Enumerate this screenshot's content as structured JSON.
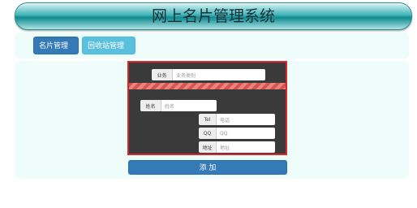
{
  "header": {
    "title": "网上名片管理系统"
  },
  "nav": {
    "cards_menu": "名片管理",
    "recycle_menu": "回收站管理"
  },
  "form": {
    "business": {
      "label": "业务",
      "placeholder": "业务类别"
    },
    "name": {
      "label": "姓名",
      "placeholder": "姓名"
    },
    "tel": {
      "label": "Tel",
      "placeholder": "电话"
    },
    "qq": {
      "label": "QQ",
      "placeholder": "QQ"
    },
    "address": {
      "label": "地址",
      "placeholder": "地址"
    },
    "submit_label": "添 加"
  },
  "colors": {
    "primary_button": "#337ab7",
    "info_button": "#5bc0de",
    "form_border": "#d8262a",
    "form_background": "#3a3a3a",
    "panel_background": "#effdfa",
    "title_bar": "#41b4b7"
  }
}
